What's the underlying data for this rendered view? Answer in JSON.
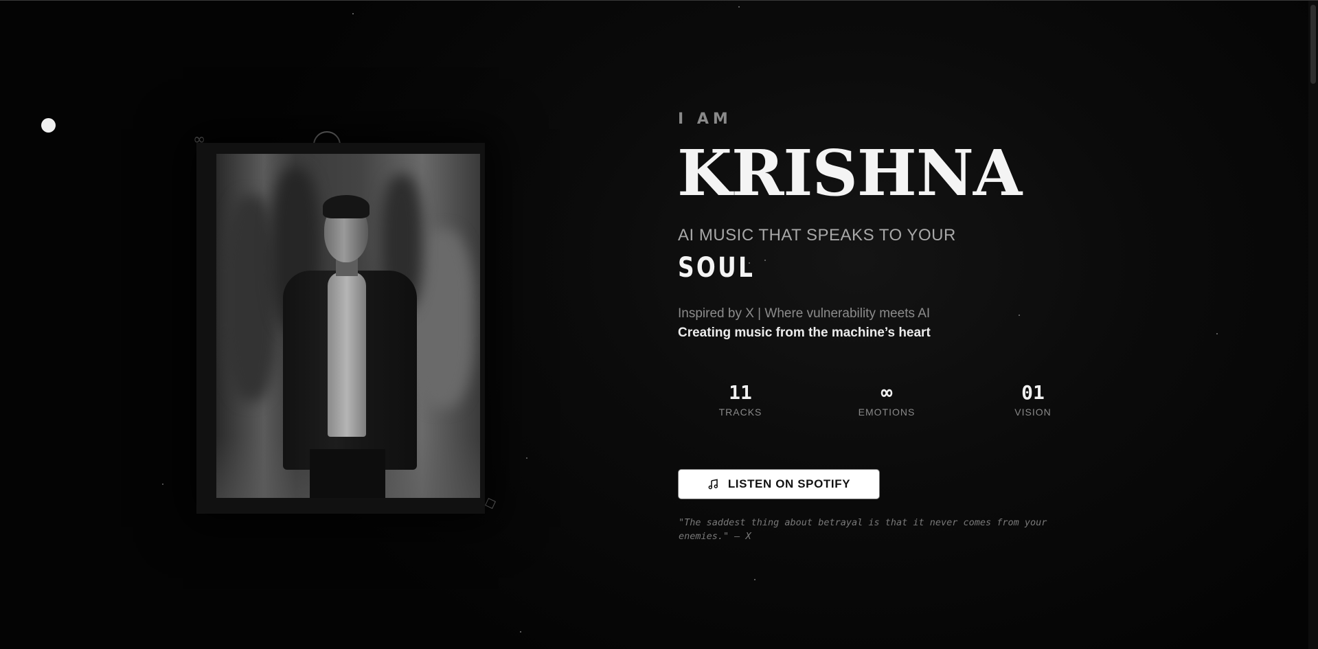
{
  "hero": {
    "eyebrow": "I AM",
    "name": "KRISHNA",
    "tagline": "AI MUSIC THAT SPEAKS TO YOUR",
    "tagline_emphasis": "SOUL",
    "subtitle": "Inspired by X | Where vulnerability meets AI",
    "subtitle_strong": "Creating music from the machine’s heart"
  },
  "stats": [
    {
      "value": "11",
      "label": "TRACKS"
    },
    {
      "value": "∞",
      "label": "EMOTIONS"
    },
    {
      "value": "01",
      "label": "VISION"
    }
  ],
  "cta": {
    "label": "LISTEN ON SPOTIFY",
    "icon": "music-note-icon"
  },
  "quote": "\"The saddest thing about betrayal is that it never comes from your enemies.\" — X",
  "decorations": {
    "infinity_symbol": "∞"
  },
  "colors": {
    "background": "#050505",
    "text_primary": "#f4f4f4",
    "text_muted": "#8a8a8a",
    "button_bg": "#ffffff"
  }
}
